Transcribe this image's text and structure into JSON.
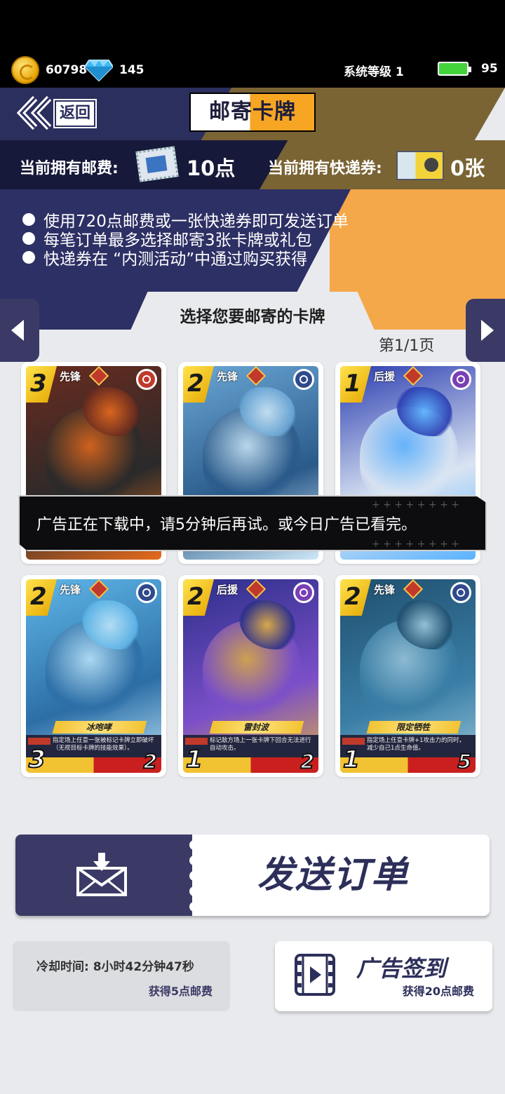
{
  "status": {
    "gold": "60798",
    "diamonds": "145",
    "system_level": "系统等级 1",
    "battery": "95"
  },
  "header": {
    "back_label": "返回",
    "title": "邮寄卡牌"
  },
  "postage": {
    "fee_label": "当前拥有邮费:",
    "fee_value": "10点",
    "voucher_label": "当前拥有快递券:",
    "voucher_value": "0张"
  },
  "rules": [
    "使用720点邮费或一张快递券即可发送订单",
    "每笔订单最多选择邮寄3张卡牌或礼包",
    "快递券在 “内测活动”中通过购买获得"
  ],
  "selector": {
    "title": "选择您要邮寄的卡牌",
    "page": "第1/1页"
  },
  "cards": [
    {
      "cost": "3",
      "role": "先锋",
      "name": "",
      "desc": "",
      "atk": "",
      "hp": "",
      "element_color": "#c0392b",
      "colors": [
        "#6b2b1f",
        "#2a2a2a",
        "#e86b1c"
      ]
    },
    {
      "cost": "2",
      "role": "先锋",
      "name": "",
      "desc": "",
      "atk": "",
      "hp": "",
      "element_color": "#2f4a8c",
      "colors": [
        "#6aa7d6",
        "#2a5a8a",
        "#cfe8f7"
      ]
    },
    {
      "cost": "1",
      "role": "后援",
      "name": "",
      "desc": "",
      "atk": "",
      "hp": "",
      "element_color": "#7b3fb5",
      "colors": [
        "#2a3cb0",
        "#d9e4f2",
        "#5ab3ff"
      ]
    },
    {
      "cost": "2",
      "role": "先锋",
      "name": "冰咆哮",
      "desc": "指定场上任意一张被标记卡牌立即破坏（无视目标卡牌的技能效果）。",
      "atk": "3",
      "hp": "2",
      "element_color": "#2f4a8c",
      "colors": [
        "#5fb6e8",
        "#2c6ea6",
        "#bfe6fa"
      ]
    },
    {
      "cost": "2",
      "role": "后援",
      "name": "雷封波",
      "desc": "标记敌方场上一张卡牌下回合无法进行自动攻击。",
      "atk": "1",
      "hp": "2",
      "element_color": "#7b3fb5",
      "colors": [
        "#2b2f8a",
        "#7b4fc8",
        "#e0b040"
      ]
    },
    {
      "cost": "2",
      "role": "先锋",
      "name": "限定牺牲",
      "desc": "指定场上任意卡牌+1攻击力的同时，减少自己1点生命值。",
      "atk": "1",
      "hp": "5",
      "element_color": "#2f4a8c",
      "colors": [
        "#1f4f6e",
        "#3a7ea6",
        "#9cc7dc"
      ]
    }
  ],
  "toast": "广告正在下载中，请5分钟后再试。或今日广告已看完。",
  "send_button": "发送订单",
  "cooldown": {
    "label": "冷却时间: 8小时42分钟47秒",
    "reward": "获得5点邮费"
  },
  "ad_checkin": {
    "label": "广告签到",
    "reward": "获得20点邮费"
  },
  "icons": {
    "gold": "gold-coin-icon",
    "diamond": "diamond-icon",
    "battery": "battery-icon",
    "back": "double-chevron-left-icon",
    "stamp": "postage-stamp-icon",
    "ticket": "express-voucher-icon",
    "envelope": "envelope-download-icon",
    "video": "video-play-icon"
  }
}
